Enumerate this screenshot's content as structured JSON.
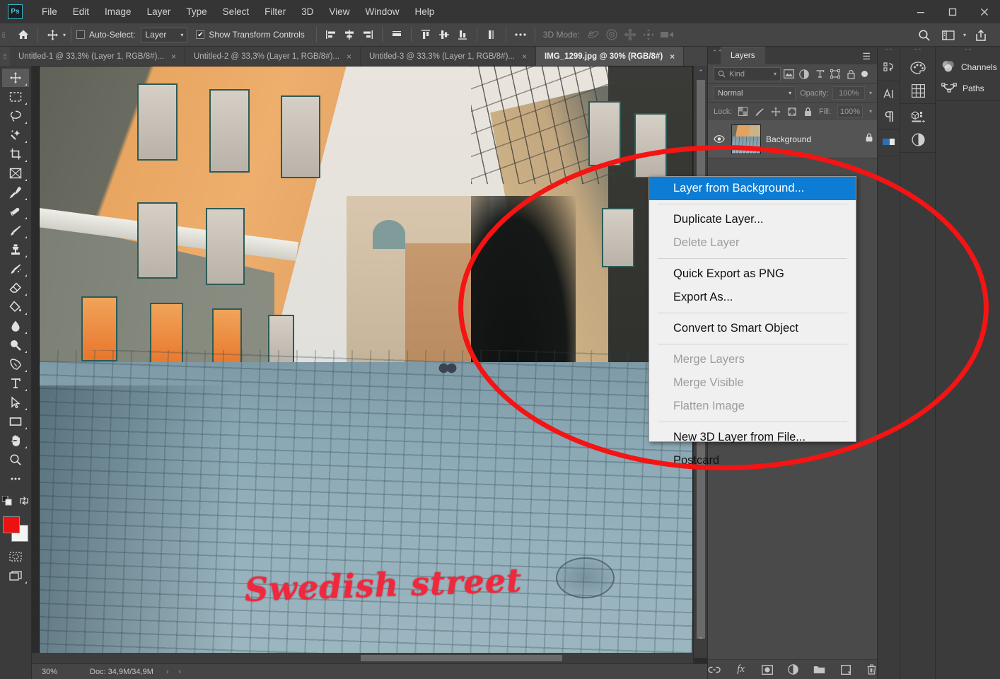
{
  "app": {
    "logo_text": "Ps",
    "window_controls": {
      "minimize": "minimize-icon",
      "maximize": "maximize-icon",
      "close": "close-icon"
    }
  },
  "menubar": {
    "items": [
      "File",
      "Edit",
      "Image",
      "Layer",
      "Type",
      "Select",
      "Filter",
      "3D",
      "View",
      "Window",
      "Help"
    ]
  },
  "options_bar": {
    "home_icon": "home-icon",
    "tool_icon": "move-tool-icon",
    "auto_select_label": "Auto-Select:",
    "auto_select_checked": false,
    "layer_select_value": "Layer",
    "show_transform_label": "Show Transform Controls",
    "show_transform_checked": true,
    "align_icons": [
      "align-left-edges",
      "align-horizontal-centers",
      "align-right-edges",
      "distribute-horizontal"
    ],
    "distribute_icons": [
      "align-top-edges",
      "align-vertical-centers",
      "align-bottom-edges",
      "distribute-vertical"
    ],
    "more_icon": "more-options-icon",
    "three_d_mode_label": "3D Mode:",
    "three_d_icons": [
      "orbit-3d-icon",
      "roll-3d-icon",
      "pan-3d-icon",
      "slide-3d-icon",
      "camera-3d-icon"
    ],
    "right_icons": [
      "search-icon",
      "workspace-icon",
      "chevron-down-icon",
      "share-icon"
    ]
  },
  "tabs": [
    {
      "label": "Untitled-1 @ 33,3% (Layer 1, RGB/8#)...",
      "active": false,
      "close": "×"
    },
    {
      "label": "Untitled-2 @ 33,3% (Layer 1, RGB/8#)...",
      "active": false,
      "close": "×"
    },
    {
      "label": "Untitled-3 @ 33,3% (Layer 1, RGB/8#)...",
      "active": false,
      "close": "×"
    },
    {
      "label": "IMG_1299.jpg @ 30% (RGB/8#)",
      "active": true,
      "close": "×"
    }
  ],
  "toolbar": {
    "tools": [
      "move-tool-icon",
      "rectangular-marquee-icon",
      "lasso-icon",
      "quick-selection-icon",
      "crop-tool-icon",
      "frame-tool-icon",
      "eyedropper-icon",
      "healing-brush-icon",
      "brush-tool-icon",
      "clone-stamp-icon",
      "history-brush-icon",
      "eraser-icon",
      "paint-bucket-icon",
      "blur-tool-icon",
      "dodge-tool-icon",
      "pen-tool-icon",
      "type-tool-icon",
      "path-selection-icon",
      "rectangle-tool-icon",
      "hand-tool-icon",
      "zoom-tool-icon",
      "more-tools-icon"
    ],
    "swap_colors_icon": "swap-colors-icon",
    "default_colors_icon": "default-colors-icon",
    "foreground_color": "#ee1111",
    "background_color": "#f4f4f4",
    "quick_mask_icon": "quick-mask-icon",
    "screen_mode_icon": "screen-mode-icon"
  },
  "canvas": {
    "watermark_text": "Swedish street",
    "watermark_color": "#f1283c"
  },
  "status_bar": {
    "zoom": "30%",
    "doc_info": "Doc: 34,9M/34,9M",
    "expand_arrow": "›",
    "collapse_arrow": "‹"
  },
  "layers_panel": {
    "tab_label": "Layers",
    "menu_icon": "panel-menu-icon",
    "collapse_icon": "collapse-panel-icon",
    "filter": {
      "kind_label": "Kind",
      "search_icon": "search-icon",
      "type_filters": [
        "pixel-layers-icon",
        "adjustment-layers-icon",
        "type-layers-icon",
        "shape-layers-icon",
        "smart-object-icon"
      ],
      "toggle_icon": "filter-toggle-icon"
    },
    "blend_mode": "Normal",
    "opacity_label": "Opacity:",
    "opacity_value": "100%",
    "lock_label": "Lock:",
    "lock_icons": [
      "lock-transparent-pixels-icon",
      "lock-image-pixels-icon",
      "lock-position-icon",
      "lock-artboard-icon",
      "lock-all-icon"
    ],
    "fill_label": "Fill:",
    "fill_value": "100%",
    "layers": [
      {
        "name": "Background",
        "visible": true,
        "locked": true,
        "visibility_icon": "eye-icon",
        "lock_icon": "lock-icon",
        "thumbnail": "layer-thumbnail"
      }
    ],
    "footer_icons": [
      "link-layers-icon",
      "layer-style-fx-icon",
      "add-layer-mask-icon",
      "new-adjustment-layer-icon",
      "new-group-icon",
      "new-layer-icon",
      "delete-layer-icon"
    ]
  },
  "context_menu": {
    "items": [
      {
        "label": "Layer from Background...",
        "state": "selected"
      },
      {
        "sep": true
      },
      {
        "label": "Duplicate Layer...",
        "state": "normal"
      },
      {
        "label": "Delete Layer",
        "state": "disabled"
      },
      {
        "sep": true
      },
      {
        "label": "Quick Export as PNG",
        "state": "normal"
      },
      {
        "label": "Export As...",
        "state": "normal"
      },
      {
        "sep": true
      },
      {
        "label": "Convert to Smart Object",
        "state": "normal"
      },
      {
        "sep": true
      },
      {
        "label": "Merge Layers",
        "state": "disabled"
      },
      {
        "label": "Merge Visible",
        "state": "disabled"
      },
      {
        "label": "Flatten Image",
        "state": "disabled"
      },
      {
        "sep": true
      },
      {
        "label": "New 3D Layer from File...",
        "state": "normal"
      },
      {
        "label": "Postcard",
        "state": "normal"
      }
    ],
    "highlight_color": "#0c7cd5"
  },
  "right_rails": {
    "rail1": [
      "history-icon",
      "character-icon",
      "paragraph-icon"
    ],
    "rail2": [
      "color-swatches-icon",
      "pattern-grid-icon",
      "3d-panel-icon",
      "adjustments-icon"
    ],
    "rail3_items": [
      {
        "icon": "channels-icon",
        "label": "Channels"
      },
      {
        "icon": "paths-icon",
        "label": "Paths"
      }
    ]
  },
  "annotation": {
    "shape": "red-ellipse-highlight",
    "color": "#f41414"
  }
}
